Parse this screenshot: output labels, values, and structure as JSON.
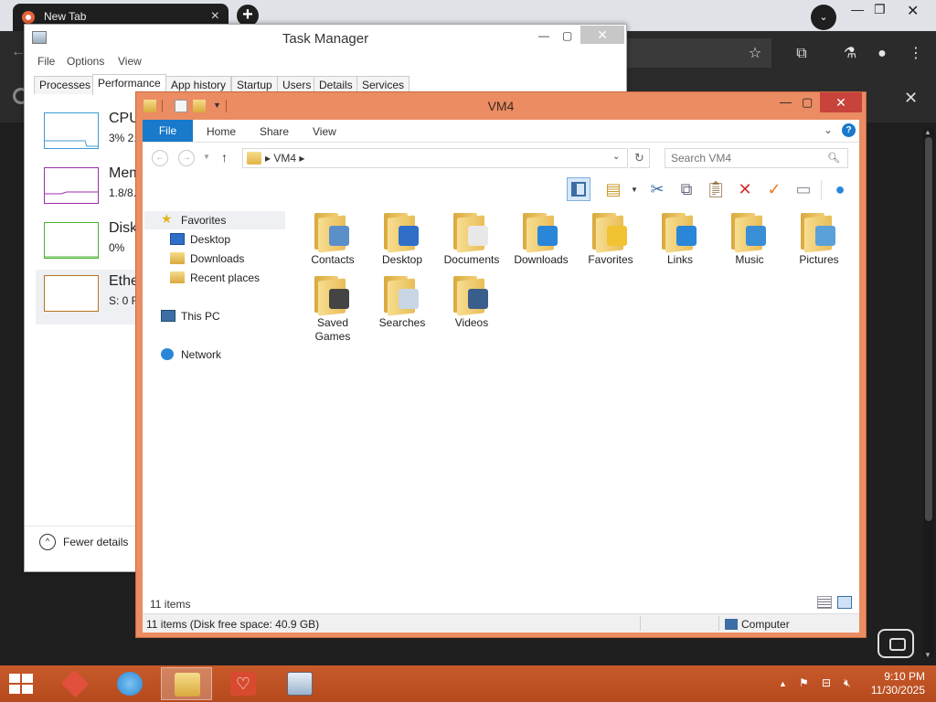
{
  "browser": {
    "tab_title": "New Tab",
    "tab_close": "×",
    "new_tab": "+",
    "tab_search": "⌄",
    "info_close": "✕",
    "icons": [
      "bookmark-star-icon",
      "extensions-icon",
      "labs-icon",
      "profile-icon",
      "menu-icon"
    ]
  },
  "task_manager": {
    "title": "Task Manager",
    "menu": [
      "File",
      "Options",
      "View"
    ],
    "tabs": [
      "Processes",
      "Performance",
      "App history",
      "Startup",
      "Users",
      "Details",
      "Services"
    ],
    "active_tab": "Performance",
    "perf_items": [
      {
        "name": "CPU",
        "value": "3% 2.",
        "color": "#3c9ad2"
      },
      {
        "name": "Mem",
        "value": "1.8/8.",
        "color": "#9b2ea8"
      },
      {
        "name": "Disk",
        "value": "0%",
        "color": "#4caf30"
      },
      {
        "name": "Ethe",
        "value": "S: 0 R",
        "color": "#b7731f"
      }
    ],
    "fewer_details": "Fewer details",
    "fewer_icon": "^"
  },
  "explorer": {
    "title": "VM4",
    "ribbon": {
      "file": "File",
      "tabs": [
        "Home",
        "Share",
        "View"
      ],
      "help": "?"
    },
    "address": {
      "crumb": "▸  VM4  ▸"
    },
    "search": {
      "placeholder": "Search VM4"
    },
    "nav": {
      "favorites": "Favorites",
      "desktop": "Desktop",
      "downloads": "Downloads",
      "recent": "Recent places",
      "this_pc": "This PC",
      "network": "Network"
    },
    "files": [
      {
        "name": "Contacts",
        "badge": "contacts-badge",
        "color": "#5b8fc8"
      },
      {
        "name": "Desktop",
        "badge": "desktop-badge",
        "color": "#2f6fc7"
      },
      {
        "name": "Documents",
        "badge": "documents-badge",
        "color": "#e8e8e8"
      },
      {
        "name": "Downloads",
        "badge": "downloads-badge",
        "color": "#2a86d8"
      },
      {
        "name": "Favorites",
        "badge": "favorites-badge",
        "color": "#f1c232"
      },
      {
        "name": "Links",
        "badge": "links-badge",
        "color": "#2a86d8"
      },
      {
        "name": "Music",
        "badge": "music-badge",
        "color": "#3a8ed6"
      },
      {
        "name": "Pictures",
        "badge": "pictures-badge",
        "color": "#5aa1d9"
      },
      {
        "name": "Saved Games",
        "badge": "saved-games-badge",
        "color": "#444444"
      },
      {
        "name": "Searches",
        "badge": "searches-badge",
        "color": "#c9d6e3"
      },
      {
        "name": "Videos",
        "badge": "videos-badge",
        "color": "#3a5e8c"
      }
    ],
    "status_count": "11 items",
    "status_disk": "11 items (Disk free space: 40.9 GB)",
    "status_computer": "Computer"
  },
  "taskbar": {
    "apps": [
      "app-1-icon",
      "ie-icon",
      "file-explorer-icon",
      "health-icon",
      "task-manager-icon"
    ],
    "time": "9:10 PM",
    "date": "11/30/2025"
  }
}
